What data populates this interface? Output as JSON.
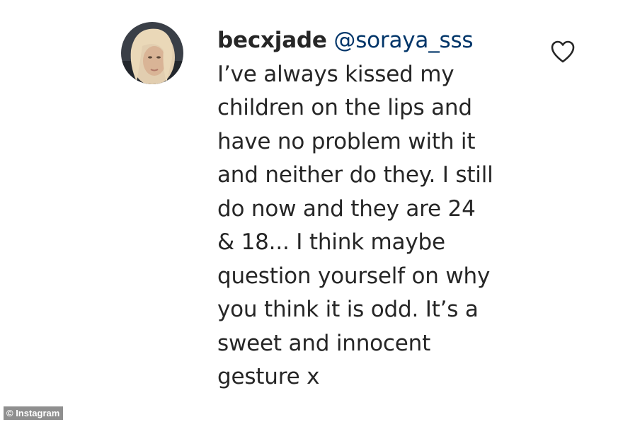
{
  "comment": {
    "username": "becxjade",
    "mention": "@soraya_sss",
    "text": "I’ve always kissed my\nchildren on the lips and\nhave no problem with it\nand neither do they. I still\ndo now and they are 24\n& 18... I think maybe\nquestion yourself on why\nyou think it is odd. It’s a\nsweet and innocent\ngesture x",
    "avatar_icon": "profile-photo",
    "like_icon": "heart-outline-icon"
  },
  "credit": {
    "label": "© Instagram"
  },
  "colors": {
    "text": "#262626",
    "mention": "#003569",
    "credit_bg": "#8f8f8f",
    "credit_text": "#ffffff"
  }
}
